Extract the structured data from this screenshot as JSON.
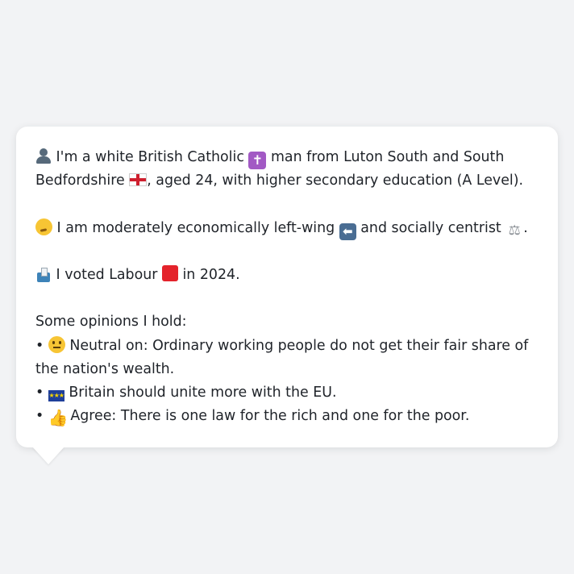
{
  "profile": {
    "line1_a": "I'm a white British Catholic",
    "line1_b": "man from Luton South and South Bedfordshire",
    "line1_c": ", aged 24, with higher secondary education (A Level).",
    "line2_a": "I am moderately economically left-wing",
    "line2_b": "and socially centrist",
    "line2_c": ".",
    "line3_a": "I voted Labour",
    "line3_b": "in 2024.",
    "labour_color": "#e4232b"
  },
  "opinions": {
    "heading": "Some opinions I hold:",
    "bullet": "•",
    "items": [
      {
        "icon": "neutral-face-icon",
        "text": "Neutral on: Ordinary working people do not get their fair share of the nation's wealth."
      },
      {
        "icon": "eu-flag-icon",
        "text": "Britain should unite more with the EU."
      },
      {
        "icon": "thumbs-up-icon",
        "text": "Agree: There is one law for the rich and one for the poor."
      }
    ]
  },
  "icons": {
    "cross_glyph": "✝",
    "left_glyph": "⬅",
    "scales_glyph": "⚖",
    "thumb_glyph": "👍",
    "eu_stars": "★★★"
  }
}
